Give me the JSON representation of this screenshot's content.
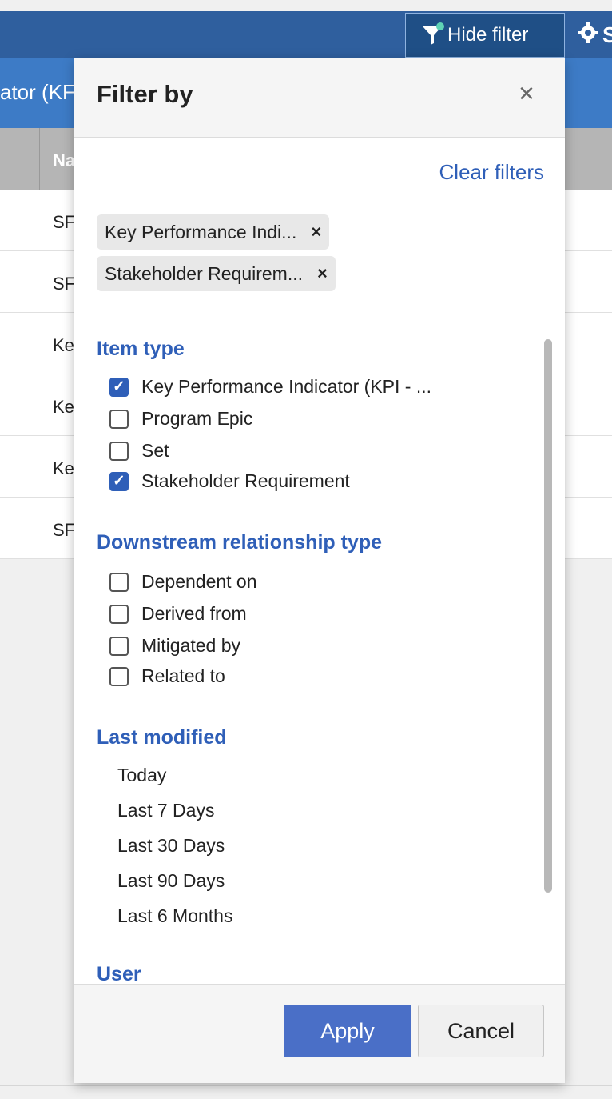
{
  "toolbar": {
    "hide_filter_label": "Hide filter",
    "settings_label": "S"
  },
  "background": {
    "header_fragment": "ator (KF",
    "name_column": "Na",
    "rows": [
      "SF",
      "SF",
      "Ke",
      "Ke",
      "Ke",
      "SF"
    ]
  },
  "filter_panel": {
    "title": "Filter by",
    "close_glyph": "×",
    "clear_filters": "Clear filters",
    "chips": [
      {
        "label": "Key Performance Indi...",
        "remove": "×"
      },
      {
        "label": "Stakeholder Requirem...",
        "remove": "×"
      }
    ],
    "item_type": {
      "heading": "Item type",
      "options": [
        {
          "label": "Key Performance Indicator (KPI - ...",
          "checked": true
        },
        {
          "label": "Program Epic",
          "checked": false
        },
        {
          "label": "Set",
          "checked": false
        },
        {
          "label": "Stakeholder Requirement",
          "checked": true
        }
      ]
    },
    "downstream": {
      "heading": "Downstream relationship type",
      "options": [
        {
          "label": "Dependent on",
          "checked": false
        },
        {
          "label": "Derived from",
          "checked": false
        },
        {
          "label": "Mitigated by",
          "checked": false
        },
        {
          "label": "Related to",
          "checked": false
        }
      ]
    },
    "last_modified": {
      "heading": "Last modified",
      "options": [
        "Today",
        "Last 7 Days",
        "Last 30 Days",
        "Last 90 Days",
        "Last 6 Months"
      ]
    },
    "user": {
      "heading": "User"
    },
    "apply_label": "Apply",
    "cancel_label": "Cancel"
  },
  "colors": {
    "accent": "#2f5fb8",
    "toolbar": "#2f5f9e",
    "apply_button": "#4a6fc7"
  }
}
